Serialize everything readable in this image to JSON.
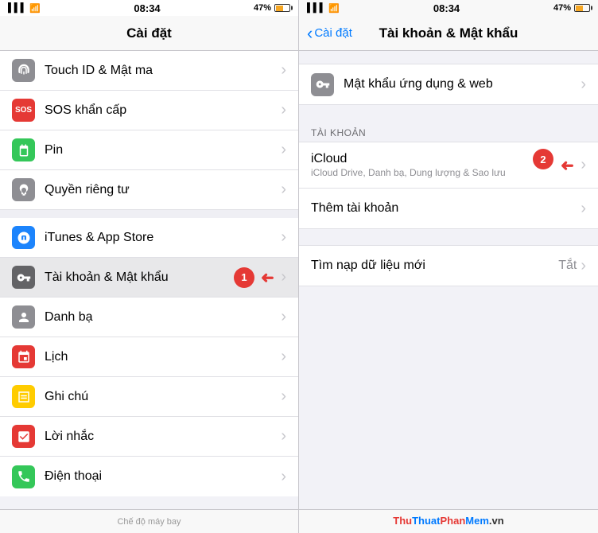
{
  "left": {
    "status": {
      "time": "08:34",
      "battery_pct": "47%",
      "signal": "▌▌▌",
      "wifi": "wifi"
    },
    "title": "Cài đặt",
    "items": [
      {
        "id": "touch-id",
        "label": "Touch ID & Mật ma",
        "icon_color": "gray",
        "icon": "fingerprint"
      },
      {
        "id": "sos",
        "label": "SOS khẩn cấp",
        "icon_color": "red",
        "icon": "SOS"
      },
      {
        "id": "pin",
        "label": "Pin",
        "icon_color": "green",
        "icon": "battery"
      },
      {
        "id": "privacy",
        "label": "Quyền riêng tư",
        "icon_color": "gray",
        "icon": "hand"
      },
      {
        "id": "itunes",
        "label": "iTunes & App Store",
        "icon_color": "app-store",
        "icon": "A"
      },
      {
        "id": "accounts",
        "label": "Tài khoản & Mật khẩu",
        "icon_color": "key",
        "icon": "key",
        "highlighted": true,
        "badge": "1"
      },
      {
        "id": "contacts",
        "label": "Danh bạ",
        "icon_color": "gray",
        "icon": "person"
      },
      {
        "id": "calendar",
        "label": "Lịch",
        "icon_color": "red",
        "icon": "cal"
      },
      {
        "id": "notes",
        "label": "Ghi chú",
        "icon_color": "yellow",
        "icon": "note"
      },
      {
        "id": "reminders",
        "label": "Lời nhắc",
        "icon_color": "red",
        "icon": "list"
      },
      {
        "id": "phone",
        "label": "Điện thoại",
        "icon_color": "phone",
        "icon": "phone"
      }
    ],
    "bottom": "Chế độ máy bay"
  },
  "right": {
    "status": {
      "time": "08:34",
      "battery_pct": "47%"
    },
    "back_label": "Cài đặt",
    "title": "Tài khoản & Mật khẩu",
    "sections": [
      {
        "id": "passwords",
        "items": [
          {
            "id": "passwords-web",
            "label": "Mật khẩu ứng dụng & web",
            "icon_color": "key",
            "has_chevron": true
          }
        ]
      },
      {
        "id": "accounts",
        "header": "TÀI KHOẢN",
        "items": [
          {
            "id": "icloud",
            "label": "iCloud",
            "sublabel": "iCloud Drive, Danh bạ, Dung lượng & Sao lưu",
            "has_chevron": true,
            "badge": "2"
          },
          {
            "id": "add-account",
            "label": "Thêm tài khoản",
            "has_chevron": true
          }
        ]
      },
      {
        "id": "fetch",
        "items": [
          {
            "id": "fetch-new",
            "label": "Tìm nạp dữ liệu mới",
            "value": "Tắt",
            "has_chevron": true
          }
        ]
      }
    ],
    "bottom_watermark": "ThuThuatPhanMem.vn"
  }
}
